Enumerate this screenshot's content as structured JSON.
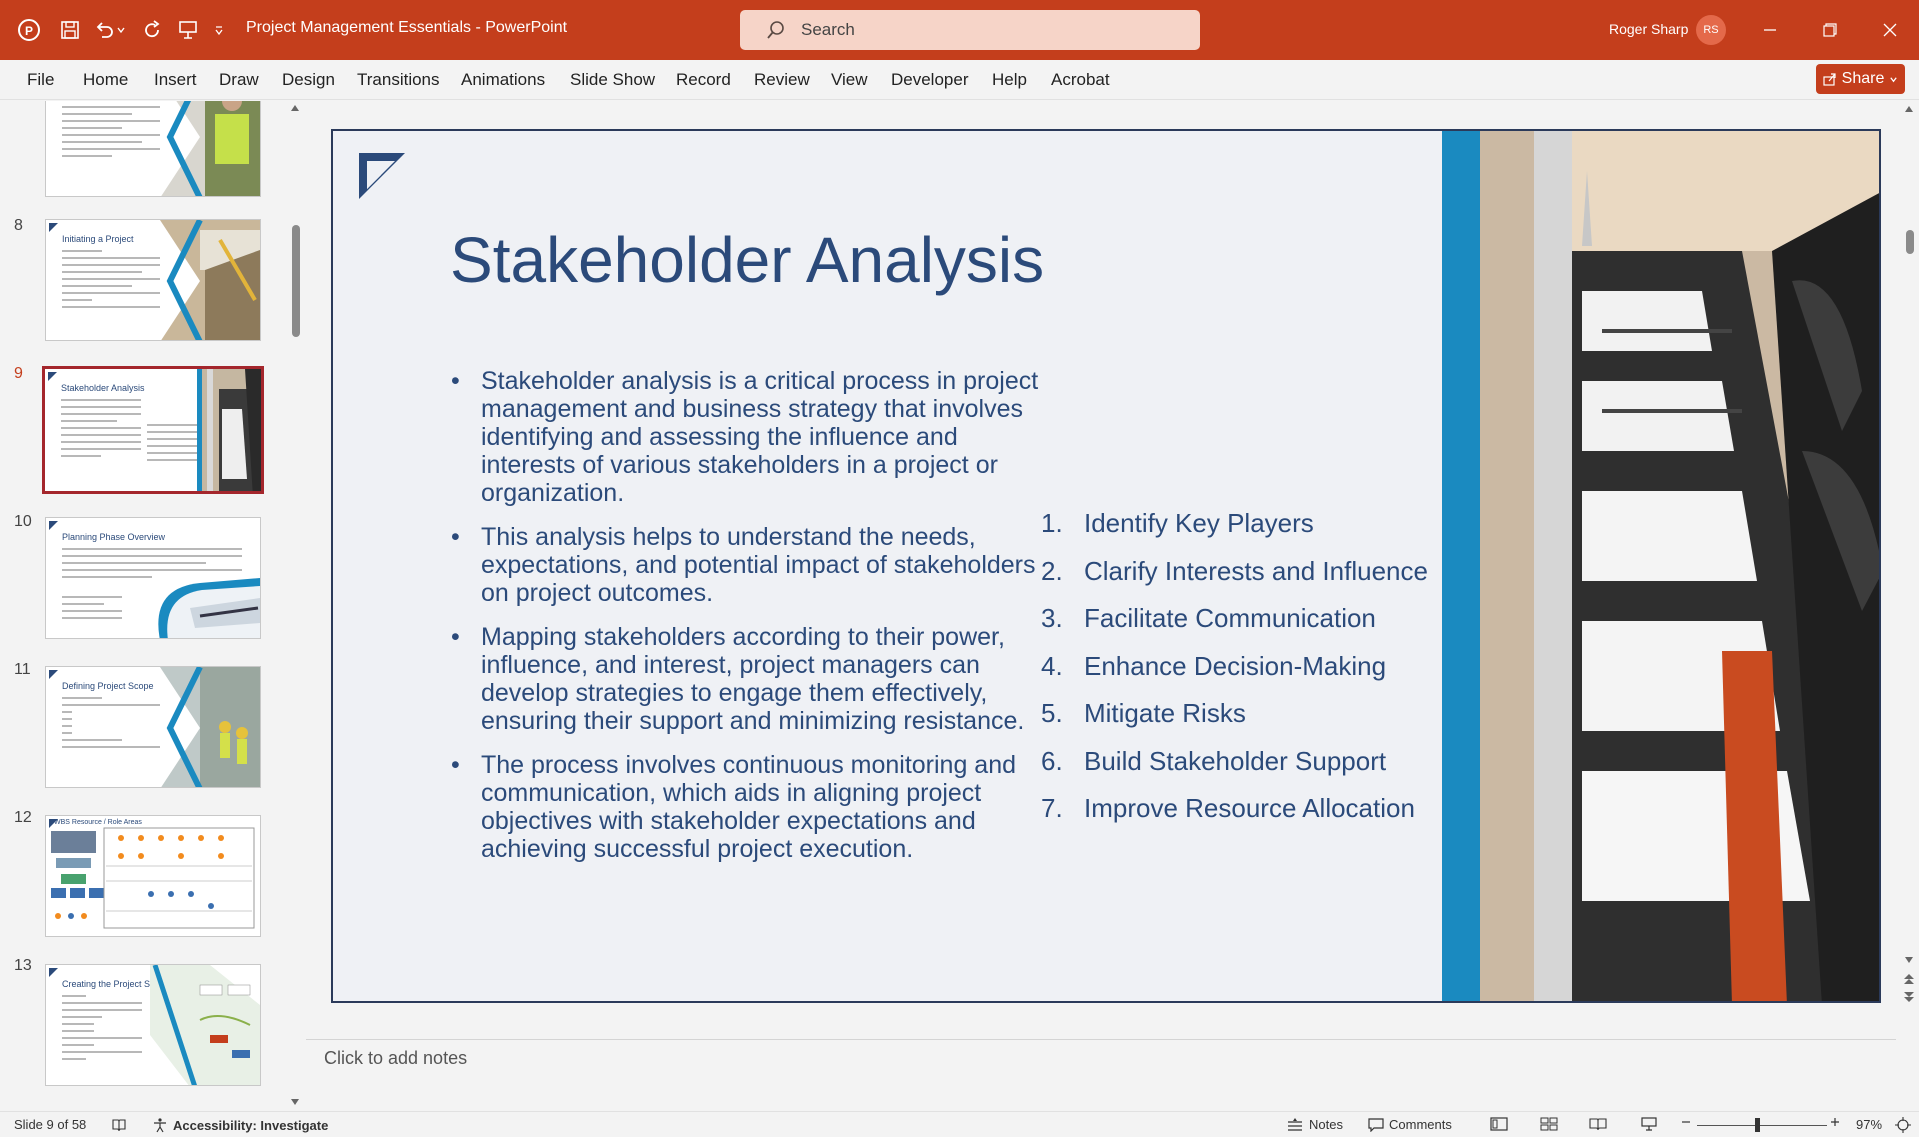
{
  "app": {
    "doc_title": "Project Management Essentials  -  PowerPoint",
    "search_placeholder": "Search",
    "user_name": "Roger Sharp",
    "user_initials": "RS",
    "brand_color": "#c43e1c"
  },
  "menu": {
    "items": [
      "File",
      "Home",
      "Insert",
      "Draw",
      "Design",
      "Transitions",
      "Animations",
      "Slide Show",
      "Record",
      "Review",
      "View",
      "Developer",
      "Help",
      "Acrobat"
    ],
    "share_label": "Share"
  },
  "thumbnails": [
    {
      "number": "",
      "title": "",
      "icon": "construction-worker-photo"
    },
    {
      "number": "8",
      "title": "Initiating a Project",
      "icon": "construction-site-photo"
    },
    {
      "number": "9",
      "title": "Stakeholder Analysis",
      "icon": "boardroom-photo",
      "active": true
    },
    {
      "number": "10",
      "title": "Planning Phase Overview",
      "icon": "pen-paper-photo"
    },
    {
      "number": "11",
      "title": "Defining Project Scope",
      "icon": "workers-photo"
    },
    {
      "number": "12",
      "title": "WBS Resource / Role Areas",
      "icon": "org-chart"
    },
    {
      "number": "13",
      "title": "Creating the Project Schedule",
      "icon": "schedule-map"
    }
  ],
  "slide": {
    "title": "Stakeholder Analysis",
    "bullets": [
      "Stakeholder analysis is a critical process in project management and business strategy that involves identifying and assessing the influence and interests of various stakeholders in a project or organization.",
      "This analysis helps to understand the needs, expectations, and potential impact of stakeholders on project outcomes.",
      "Mapping stakeholders according to their power, influence, and interest, project managers can develop strategies to engage them effectively, ensuring their support and minimizing resistance.",
      "The process involves continuous monitoring and communication, which aids in aligning project objectives with stakeholder expectations and achieving successful project execution."
    ],
    "numbered": [
      {
        "n": "1.",
        "text": "Identify Key Players"
      },
      {
        "n": "2.",
        "text": "Clarify Interests and Influence"
      },
      {
        "n": "3.",
        "text": "Facilitate Communication"
      },
      {
        "n": "4.",
        "text": "Enhance Decision-Making"
      },
      {
        "n": "5.",
        "text": "Mitigate Risks"
      },
      {
        "n": "6.",
        "text": "Build Stakeholder Support"
      },
      {
        "n": "7.",
        "text": "Improve Resource Allocation"
      }
    ],
    "accent_color": "#2b4a7a"
  },
  "notes": {
    "placeholder": "Click to add notes"
  },
  "status": {
    "slide_count": "Slide 9 of 58",
    "accessibility": "Accessibility: Investigate",
    "notes_label": "Notes",
    "comments_label": "Comments",
    "zoom": "97%"
  }
}
